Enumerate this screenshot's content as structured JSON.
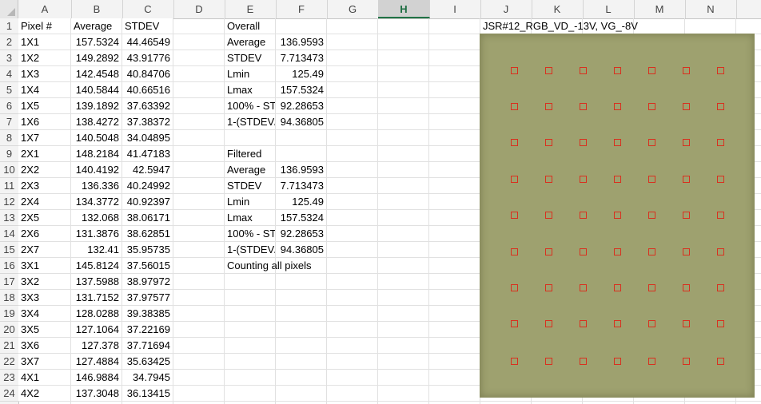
{
  "columns": [
    "A",
    "B",
    "C",
    "D",
    "E",
    "F",
    "G",
    "H",
    "I",
    "J",
    "K",
    "L",
    "M",
    "N"
  ],
  "selected_column": "H",
  "rows": [
    "1",
    "2",
    "3",
    "4",
    "5",
    "6",
    "7",
    "8",
    "9",
    "10",
    "11",
    "12",
    "13",
    "14",
    "15",
    "16",
    "17",
    "18",
    "19",
    "20",
    "21",
    "22",
    "23",
    "24"
  ],
  "table": {
    "headers": [
      "Pixel #",
      "Average",
      "STDEV"
    ],
    "data": [
      [
        "1X1",
        "157.5324",
        "44.46549"
      ],
      [
        "1X2",
        "149.2892",
        "43.91776"
      ],
      [
        "1X3",
        "142.4548",
        "40.84706"
      ],
      [
        "1X4",
        "140.5844",
        "40.66516"
      ],
      [
        "1X5",
        "139.1892",
        "37.63392"
      ],
      [
        "1X6",
        "138.4272",
        "37.38372"
      ],
      [
        "1X7",
        "140.5048",
        "34.04895"
      ],
      [
        "2X1",
        "148.2184",
        "41.47183"
      ],
      [
        "2X2",
        "140.4192",
        "42.5947"
      ],
      [
        "2X3",
        "136.336",
        "40.24992"
      ],
      [
        "2X4",
        "134.3772",
        "40.92397"
      ],
      [
        "2X5",
        "132.068",
        "38.06171"
      ],
      [
        "2X6",
        "131.3876",
        "38.62851"
      ],
      [
        "2X7",
        "132.41",
        "35.95735"
      ],
      [
        "3X1",
        "145.8124",
        "37.56015"
      ],
      [
        "3X2",
        "137.5988",
        "38.97972"
      ],
      [
        "3X3",
        "131.7152",
        "37.97577"
      ],
      [
        "3X4",
        "128.0288",
        "39.38385"
      ],
      [
        "3X5",
        "127.1064",
        "37.22169"
      ],
      [
        "3X6",
        "127.378",
        "37.71694"
      ],
      [
        "3X7",
        "127.4884",
        "35.63425"
      ],
      [
        "4X1",
        "146.9884",
        "34.7945"
      ],
      [
        "4X2",
        "137.3048",
        "36.13415"
      ]
    ]
  },
  "stats": {
    "overall_title": "Overall",
    "overall": [
      [
        "Average",
        "136.9593"
      ],
      [
        "STDEV",
        "7.713473"
      ],
      [
        "Lmin",
        "125.49"
      ],
      [
        "Lmax",
        "157.5324"
      ],
      [
        "100% - STD",
        "92.28653"
      ],
      [
        "1-(STDEV/",
        "94.36805"
      ]
    ],
    "filtered_title": "Filtered",
    "filtered": [
      [
        "Average",
        "136.9593"
      ],
      [
        "STDEV",
        "7.713473"
      ],
      [
        "Lmin",
        "125.49"
      ],
      [
        "Lmax",
        "157.5324"
      ],
      [
        "100% - STD",
        "92.28653"
      ],
      [
        "1-(STDEV/",
        "94.36805"
      ]
    ],
    "note": "Counting all pixels"
  },
  "image": {
    "caption": "JSR#12_RGB_VD_-13V, VG_-8V",
    "grid_rows": 9,
    "grid_cols": 7,
    "marker_color": "#d9301f",
    "panel_color": "#9ea16f"
  }
}
